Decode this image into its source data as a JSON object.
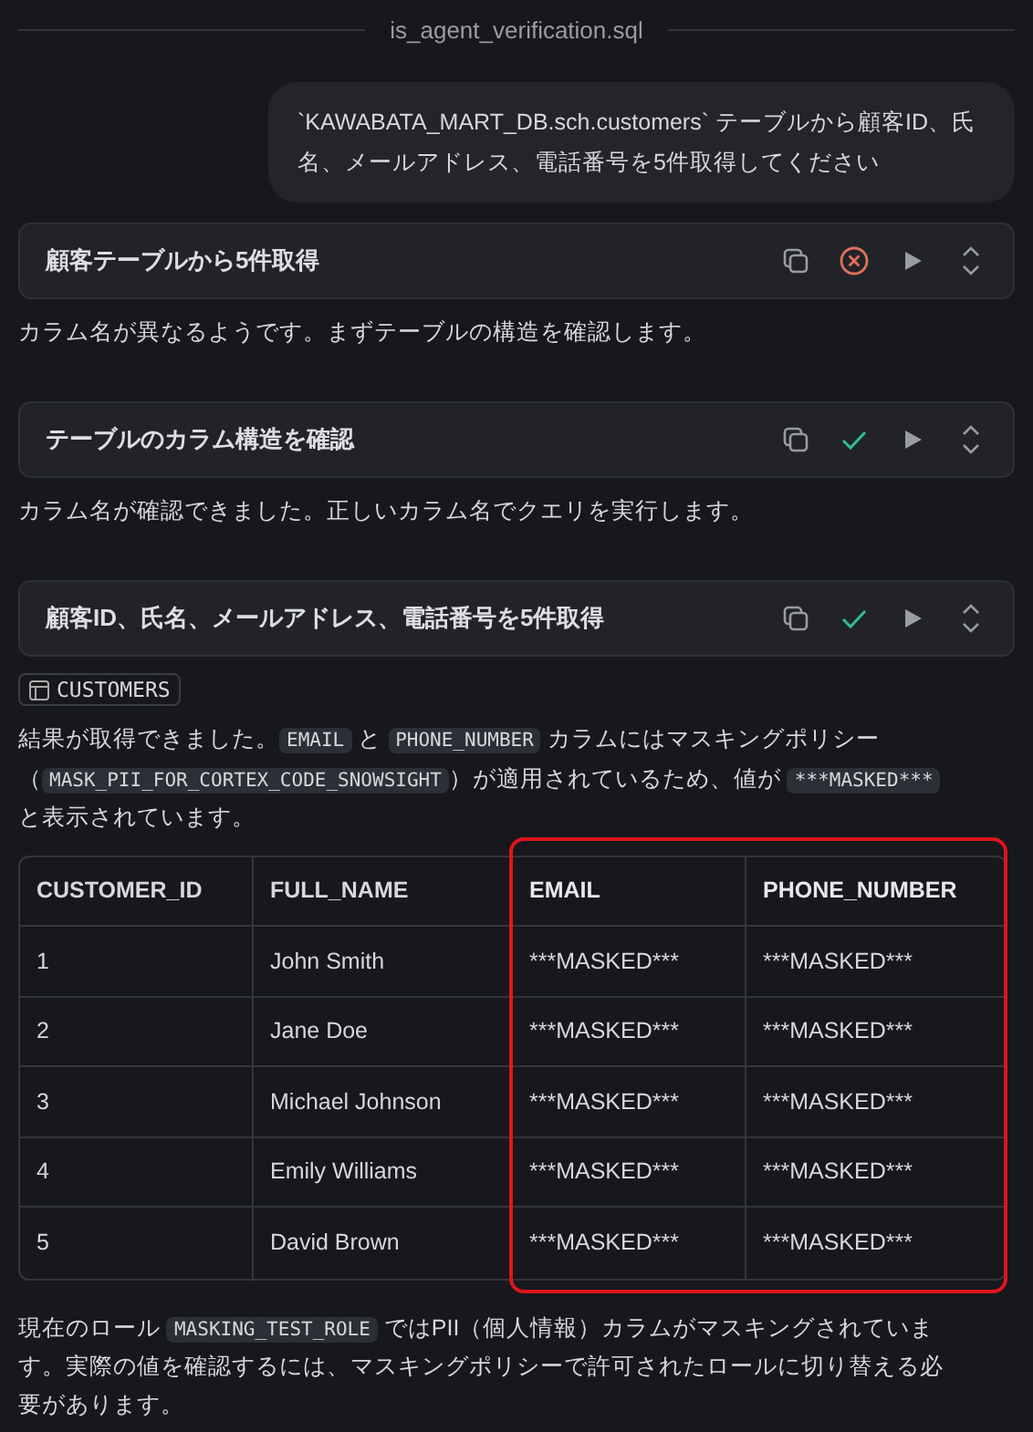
{
  "header": {
    "title": "is_agent_verification.sql"
  },
  "user_message": "`KAWABATA_MART_DB.sch.customers` テーブルから顧客ID、氏名、メールアドレス、電話番号を5件取得してください",
  "steps": [
    {
      "title": "顧客テーブルから5件取得",
      "succeeded": false,
      "note": "カラム名が異なるようです。まずテーブルの構造を確認します。"
    },
    {
      "title": "テーブルのカラム構造を確認",
      "succeeded": true,
      "note": "カラム名が確認できました。正しいカラム名でクエリを実行します。"
    },
    {
      "title": "顧客ID、氏名、メールアドレス、電話番号を5件取得",
      "succeeded": true
    }
  ],
  "table_chip": "CUSTOMERS",
  "summary": [
    {
      "kind": "text",
      "text": "結果が取得できました。"
    },
    {
      "kind": "code",
      "text": "EMAIL"
    },
    {
      "kind": "text",
      "text": " と "
    },
    {
      "kind": "code",
      "text": "PHONE_NUMBER"
    },
    {
      "kind": "text",
      "text": " カラムにはマスキングポリシー（"
    },
    {
      "kind": "code",
      "text": "MASK_PII_FOR_CORTEX_CODE_SNOWSIGHT"
    },
    {
      "kind": "text",
      "text": "）が適用されているため、値が "
    },
    {
      "kind": "code",
      "text": "***MASKED***"
    },
    {
      "kind": "text",
      "text": " と表示されています。"
    }
  ],
  "table": {
    "columns": [
      {
        "label": "CUSTOMER_ID",
        "highlighted": false
      },
      {
        "label": "FULL_NAME",
        "highlighted": false
      },
      {
        "label": "EMAIL",
        "highlighted": true
      },
      {
        "label": "PHONE_NUMBER",
        "highlighted": true
      }
    ],
    "rows": [
      [
        "1",
        "John Smith",
        "***MASKED***",
        "***MASKED***"
      ],
      [
        "2",
        "Jane Doe",
        "***MASKED***",
        "***MASKED***"
      ],
      [
        "3",
        "Michael Johnson",
        "***MASKED***",
        "***MASKED***"
      ],
      [
        "4",
        "Emily Williams",
        "***MASKED***",
        "***MASKED***"
      ],
      [
        "5",
        "David Brown",
        "***MASKED***",
        "***MASKED***"
      ]
    ]
  },
  "closing": [
    {
      "kind": "text",
      "text": "現在のロール "
    },
    {
      "kind": "code",
      "text": "MASKING_TEST_ROLE"
    },
    {
      "kind": "text",
      "text": " ではPII（個人情報）カラムがマスキングされています。実際の値を確認するには、マスキングポリシーで許可されたロールに切り替える必要があります。"
    }
  ]
}
